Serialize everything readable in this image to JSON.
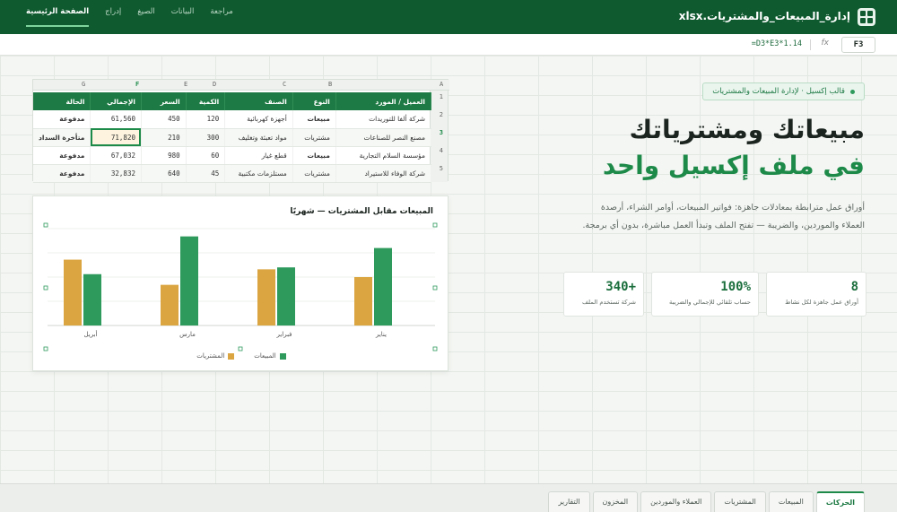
{
  "app": {
    "title": "إدارة_المبيعات_والمشتريات.xlsx",
    "icon": "grid-app-icon"
  },
  "menu": [
    {
      "label": "الصفحة الرئيسية",
      "active": true
    },
    {
      "label": "إدراج"
    },
    {
      "label": "الصيغ"
    },
    {
      "label": "البيانات"
    },
    {
      "label": "مراجعة"
    }
  ],
  "formula_bar": {
    "cell_ref": "F3",
    "fx": "fx",
    "formula": "=D3*E3*1.14"
  },
  "hero": {
    "badge": "قالب إكسيل · لإدارة المبيعات والمشتريات",
    "title_line1": "مبيعاتك ومشترياتك",
    "title_line2": "في ملف إكسيل واحد",
    "description": "أوراق عمل مترابطة بمعادلات جاهزة: فواتير المبيعات، أوامر الشراء، أرصدة العملاء والموردين، والضريبة — تفتح الملف وتبدأ العمل مباشرة، بدون أي برمجة."
  },
  "stats": [
    {
      "value": "8",
      "label": "أوراق عمل جاهزة لكل نشاط"
    },
    {
      "value": "100%",
      "label": "حساب تلقائي للإجمالي والضريبة"
    },
    {
      "value": "+340",
      "label": "شركة تستخدم الملف"
    }
  ],
  "sheet": {
    "col_letters": [
      "A",
      "B",
      "C",
      "D",
      "E",
      "F",
      "G"
    ],
    "row_numbers": [
      "1",
      "2",
      "3",
      "4",
      "5"
    ],
    "headers": [
      "العميل / المورد",
      "النوع",
      "الصنف",
      "الكمية",
      "السعر",
      "الإجمالي",
      "الحالة"
    ],
    "rows": [
      [
        "شركة ألفا للتوريدات",
        "مبيعات",
        "أجهزة كهربائية",
        "120",
        "450",
        "61,560",
        "مدفوعة"
      ],
      [
        "مصنع النصر للصناعات",
        "مشتريات",
        "مواد تعبئة وتغليف",
        "300",
        "210",
        "71,820",
        "متأخرة السداد"
      ],
      [
        "مؤسسة السلام التجارية",
        "مبيعات",
        "قطع غيار",
        "60",
        "980",
        "67,032",
        "مدفوعة"
      ],
      [
        "شركة الوفاء للاستيراد",
        "مشتريات",
        "مستلزمات مكتبية",
        "45",
        "640",
        "32,832",
        "مدفوعة"
      ]
    ]
  },
  "chart_data": {
    "type": "bar",
    "title": "المبيعات مقابل المشتريات — شهريًا",
    "categories": [
      "يناير",
      "فبراير",
      "مارس",
      "أبريل"
    ],
    "series": [
      {
        "name": "المبيعات",
        "color": "#2e9a5c",
        "values": [
          80,
          60,
          92,
          53
        ]
      },
      {
        "name": "المشتريات",
        "color": "#dba642",
        "values": [
          50,
          58,
          42,
          68
        ]
      }
    ],
    "ylim": [
      0,
      100
    ],
    "grid": true,
    "legend": "bottom"
  },
  "tabs": [
    {
      "label": "الحركات",
      "active": true
    },
    {
      "label": "المبيعات"
    },
    {
      "label": "المشتريات"
    },
    {
      "label": "العملاء والموردين"
    },
    {
      "label": "المخزون"
    },
    {
      "label": "التقارير"
    }
  ]
}
